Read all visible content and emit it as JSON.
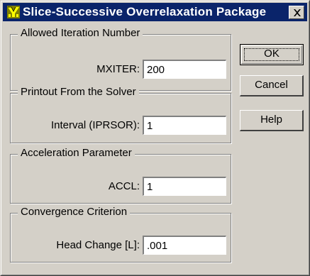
{
  "window": {
    "title": "Slice-Successive Overrelaxation Package",
    "close_glyph": "X"
  },
  "groups": [
    {
      "label": "Allowed Iteration Number",
      "field_label": "MXITER:",
      "value": "200"
    },
    {
      "label": "Printout From the Solver",
      "field_label": "Interval (IPRSOR):",
      "value": "1"
    },
    {
      "label": "Acceleration Parameter",
      "field_label": "ACCL:",
      "value": "1"
    },
    {
      "label": "Convergence Criterion",
      "field_label": "Head Change [L]:",
      "value": ".001"
    }
  ],
  "buttons": {
    "ok": "OK",
    "cancel": "Cancel",
    "help": "Help"
  },
  "colors": {
    "titlebar": "#0a246a",
    "face": "#d4d0c8"
  }
}
